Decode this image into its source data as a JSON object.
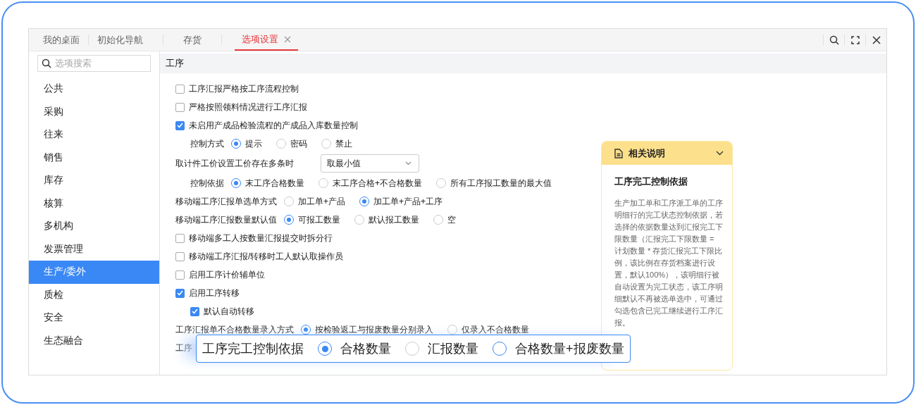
{
  "tabs": [
    {
      "label": "我的桌面",
      "selected": false,
      "closable": false
    },
    {
      "label": "初始化导航",
      "selected": false,
      "closable": false
    },
    {
      "label": "存货",
      "selected": false,
      "closable": false
    },
    {
      "label": "选项设置",
      "selected": true,
      "closable": true
    }
  ],
  "sidebar": {
    "search": {
      "placeholder": "选项搜索"
    },
    "items": [
      {
        "label": "公共",
        "selected": false
      },
      {
        "label": "采购",
        "selected": false
      },
      {
        "label": "往来",
        "selected": false
      },
      {
        "label": "销售",
        "selected": false
      },
      {
        "label": "库存",
        "selected": false
      },
      {
        "label": "核算",
        "selected": false
      },
      {
        "label": "多机构",
        "selected": false
      },
      {
        "label": "发票管理",
        "selected": false
      },
      {
        "label": "生产/委外",
        "selected": true
      },
      {
        "label": "质检",
        "selected": false
      },
      {
        "label": "安全",
        "selected": false
      },
      {
        "label": "生态融合",
        "selected": false
      }
    ]
  },
  "section": {
    "title": "工序",
    "options": [
      {
        "kind": "checkbox",
        "label": "工序汇报严格按工序流程控制",
        "checked": false
      },
      {
        "kind": "checkbox",
        "label": "严格按照领料情况进行工序汇报",
        "checked": false
      },
      {
        "kind": "checkbox",
        "label": "未启用产成品检验流程的产成品入库数量控制",
        "checked": true,
        "children": [
          {
            "kind": "radio",
            "label": "控制方式",
            "choices": [
              {
                "label": "提示",
                "selected": true
              },
              {
                "label": "密码",
                "selected": false
              },
              {
                "label": "禁止",
                "selected": false
              }
            ]
          }
        ]
      },
      {
        "kind": "select",
        "label": "取计件工价设置工价存在多条时",
        "value": "取最小值",
        "children": [
          {
            "kind": "radio",
            "label": "控制依据",
            "choices": [
              {
                "label": "末工序合格数量",
                "selected": true
              },
              {
                "label": "末工序合格+不合格数量",
                "selected": false
              },
              {
                "label": "所有工序报工数量的最大值",
                "selected": false
              }
            ]
          }
        ]
      },
      {
        "kind": "radio",
        "label": "移动端工序汇报单选单方式",
        "choices": [
          {
            "label": "加工单+产品",
            "selected": false
          },
          {
            "label": "加工单+产品+工序",
            "selected": true
          }
        ]
      },
      {
        "kind": "radio",
        "label": "移动端工序汇报数量默认值",
        "choices": [
          {
            "label": "可报工数量",
            "selected": true
          },
          {
            "label": "默认报工数量",
            "selected": false
          },
          {
            "label": "空",
            "selected": false
          }
        ]
      },
      {
        "kind": "checkbox",
        "label": "移动端多工人按数量汇报提交时拆分行",
        "checked": false
      },
      {
        "kind": "checkbox",
        "label": "移动端工序汇报/转移时工人默认取操作员",
        "checked": false
      },
      {
        "kind": "checkbox",
        "label": "启用工序计价辅单位",
        "checked": false
      },
      {
        "kind": "checkbox",
        "label": "启用工序转移",
        "checked": true,
        "children": [
          {
            "kind": "checkbox",
            "label": "默认自动转移",
            "checked": true
          }
        ]
      },
      {
        "kind": "radio",
        "label": "工序汇报单不合格数量录入方式",
        "choices": [
          {
            "label": "按检验返工与报废数量分别录入",
            "selected": true
          },
          {
            "label": "仅录入不合格数量",
            "selected": false
          }
        ]
      },
      {
        "kind": "covered",
        "label": "工序"
      }
    ]
  },
  "callout": {
    "label": "工序完工控制依据",
    "choices": [
      {
        "label": "合格数量",
        "selected": true
      },
      {
        "label": "汇报数量",
        "selected": false
      },
      {
        "label": "合格数量+报废数量",
        "selected": false
      }
    ]
  },
  "note": {
    "title": "相关说明",
    "heading": "工序完工控制依据",
    "body": "生产加工单和工序派工单的工序明细行的完工状态控制依据，若选择的依据数量达到汇报完工下限数量（汇报完工下限数量 = 计划数量 * 存货汇报完工下限比例，该比例在存货档案进行设置，默认100%），该明细行被自动设置为完工状态，该工序明细默认不再被选单选中，可通过勾选包含已完工继续进行工序汇报。"
  }
}
